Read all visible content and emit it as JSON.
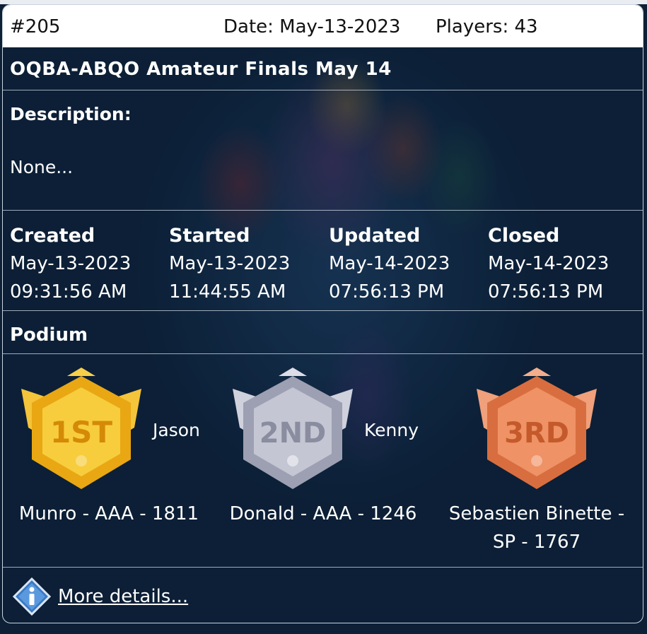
{
  "header": {
    "id": "#205",
    "date": "Date: May-13-2023",
    "players": "Players: 43"
  },
  "title": "OQBA-ABQO Amateur Finals May 14",
  "description": {
    "label": "Description:",
    "value": "None..."
  },
  "times": [
    {
      "label": "Created",
      "date": "May-13-2023",
      "time": "09:31:56 AM"
    },
    {
      "label": "Started",
      "date": "May-13-2023",
      "time": "11:44:55 AM"
    },
    {
      "label": "Updated",
      "date": "May-14-2023",
      "time": "07:56:13 PM"
    },
    {
      "label": "Closed",
      "date": "May-14-2023",
      "time": "07:56:13 PM"
    }
  ],
  "podium": {
    "label": "Podium",
    "places": [
      {
        "rank": "1ST",
        "first_name": "Jason",
        "details": "Munro - AAA - 1811",
        "color": "#f2b61f"
      },
      {
        "rank": "2ND",
        "first_name": "Kenny",
        "details": "Donald - AAA - 1246",
        "color": "#b8bac8"
      },
      {
        "rank": "3RD",
        "first_name": "",
        "details_line1": "Sebastien Binette -",
        "details_line2": "SP - 1767",
        "color": "#e8875a"
      }
    ]
  },
  "more_details": "More details..."
}
